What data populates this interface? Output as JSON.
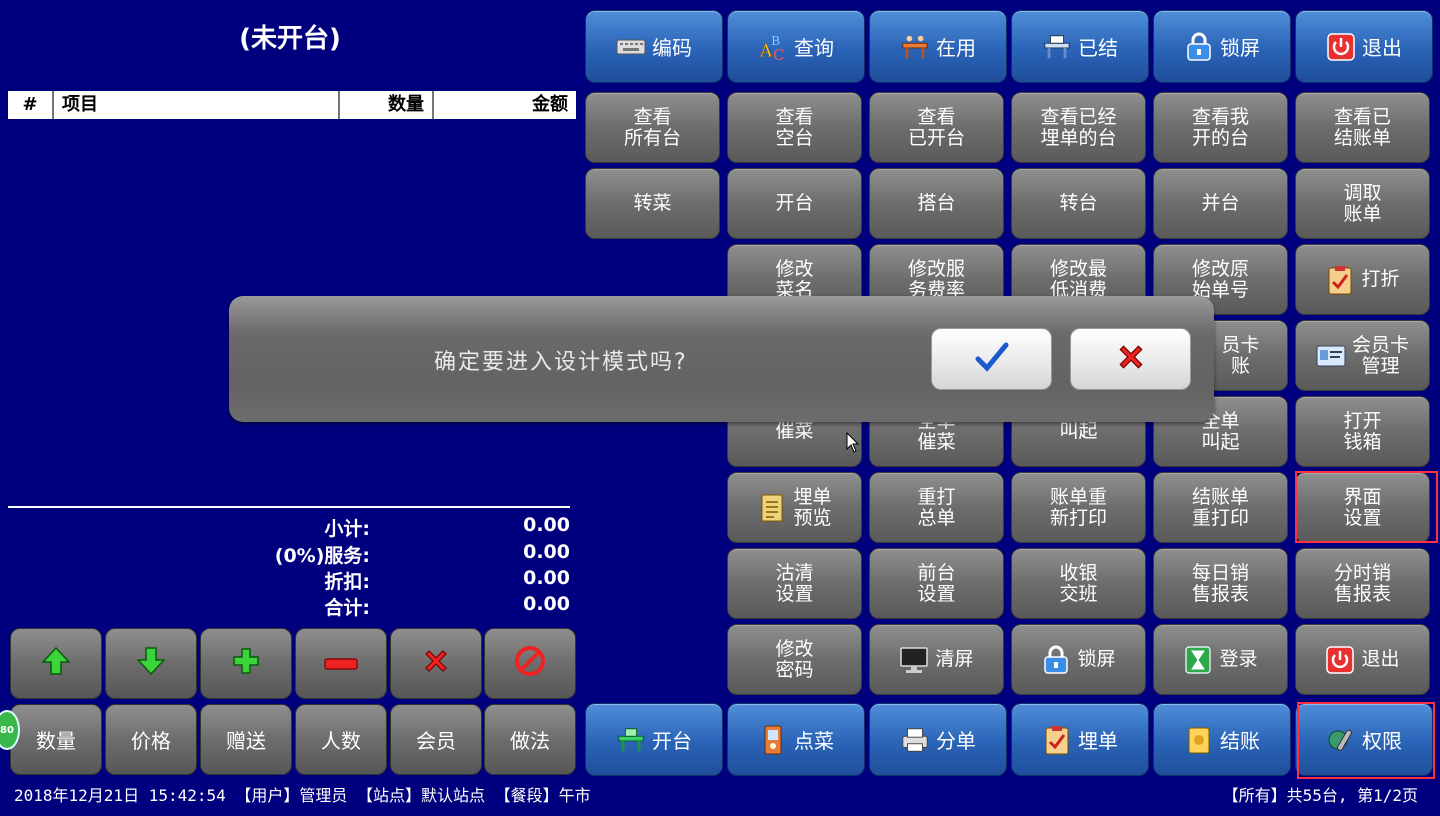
{
  "order": {
    "title": "(未开台)",
    "columns": [
      "#",
      "项目",
      "数量",
      "金额"
    ],
    "summary": [
      {
        "label": "小计:",
        "value": "0.00"
      },
      {
        "label": "(0%)服务:",
        "value": "0.00"
      },
      {
        "label": "折扣:",
        "value": "0.00"
      },
      {
        "label": "合计:",
        "value": "0.00"
      }
    ]
  },
  "top_bar": [
    "编码",
    "查询",
    "在用",
    "已结",
    "锁屏",
    "退出"
  ],
  "grid": {
    "row1": [
      "查看\n所有台",
      "查看\n空台",
      "查看\n已开台",
      "查看已经\n埋单的台",
      "查看我\n开的台",
      "查看已\n结账单"
    ],
    "row2": [
      "转菜",
      "开台",
      "搭台",
      "转台",
      "并台",
      "调取\n账单"
    ],
    "row3": [
      "修改\n菜名",
      "修改服\n务费率",
      "修改最\n低消费",
      "修改原\n始单号",
      "打折"
    ],
    "row4": [
      "员卡\n账",
      "会员卡\n管理"
    ],
    "row5": [
      "催菜",
      "全单\n催菜",
      "叫起",
      "全单\n叫起",
      "打开\n钱箱"
    ],
    "row6": [
      "埋单\n预览",
      "重打\n总单",
      "账单重\n新打印",
      "结账单\n重打印",
      "界面\n设置"
    ],
    "row7": [
      "沽清\n设置",
      "前台\n设置",
      "收银\n交班",
      "每日销\n售报表",
      "分时销\n售报表"
    ],
    "row8": [
      "修改\n密码",
      "清屏",
      "锁屏",
      "登录",
      "退出"
    ]
  },
  "left_buttons": [
    "数量",
    "价格",
    "赠送",
    "人数",
    "会员",
    "做法"
  ],
  "bottom_bar": [
    "开台",
    "点菜",
    "分单",
    "埋单",
    "结账",
    "权限"
  ],
  "dialog": {
    "message": "确定要进入设计模式吗?"
  },
  "status": {
    "left": "2018年12月21日 15:42:54 【用户】管理员 【站点】默认站点 【餐段】午市",
    "right": "【所有】共55台, 第1/2页"
  },
  "badge": "80",
  "colors": {
    "background": "#00007e",
    "highlight": "#ff3040"
  }
}
